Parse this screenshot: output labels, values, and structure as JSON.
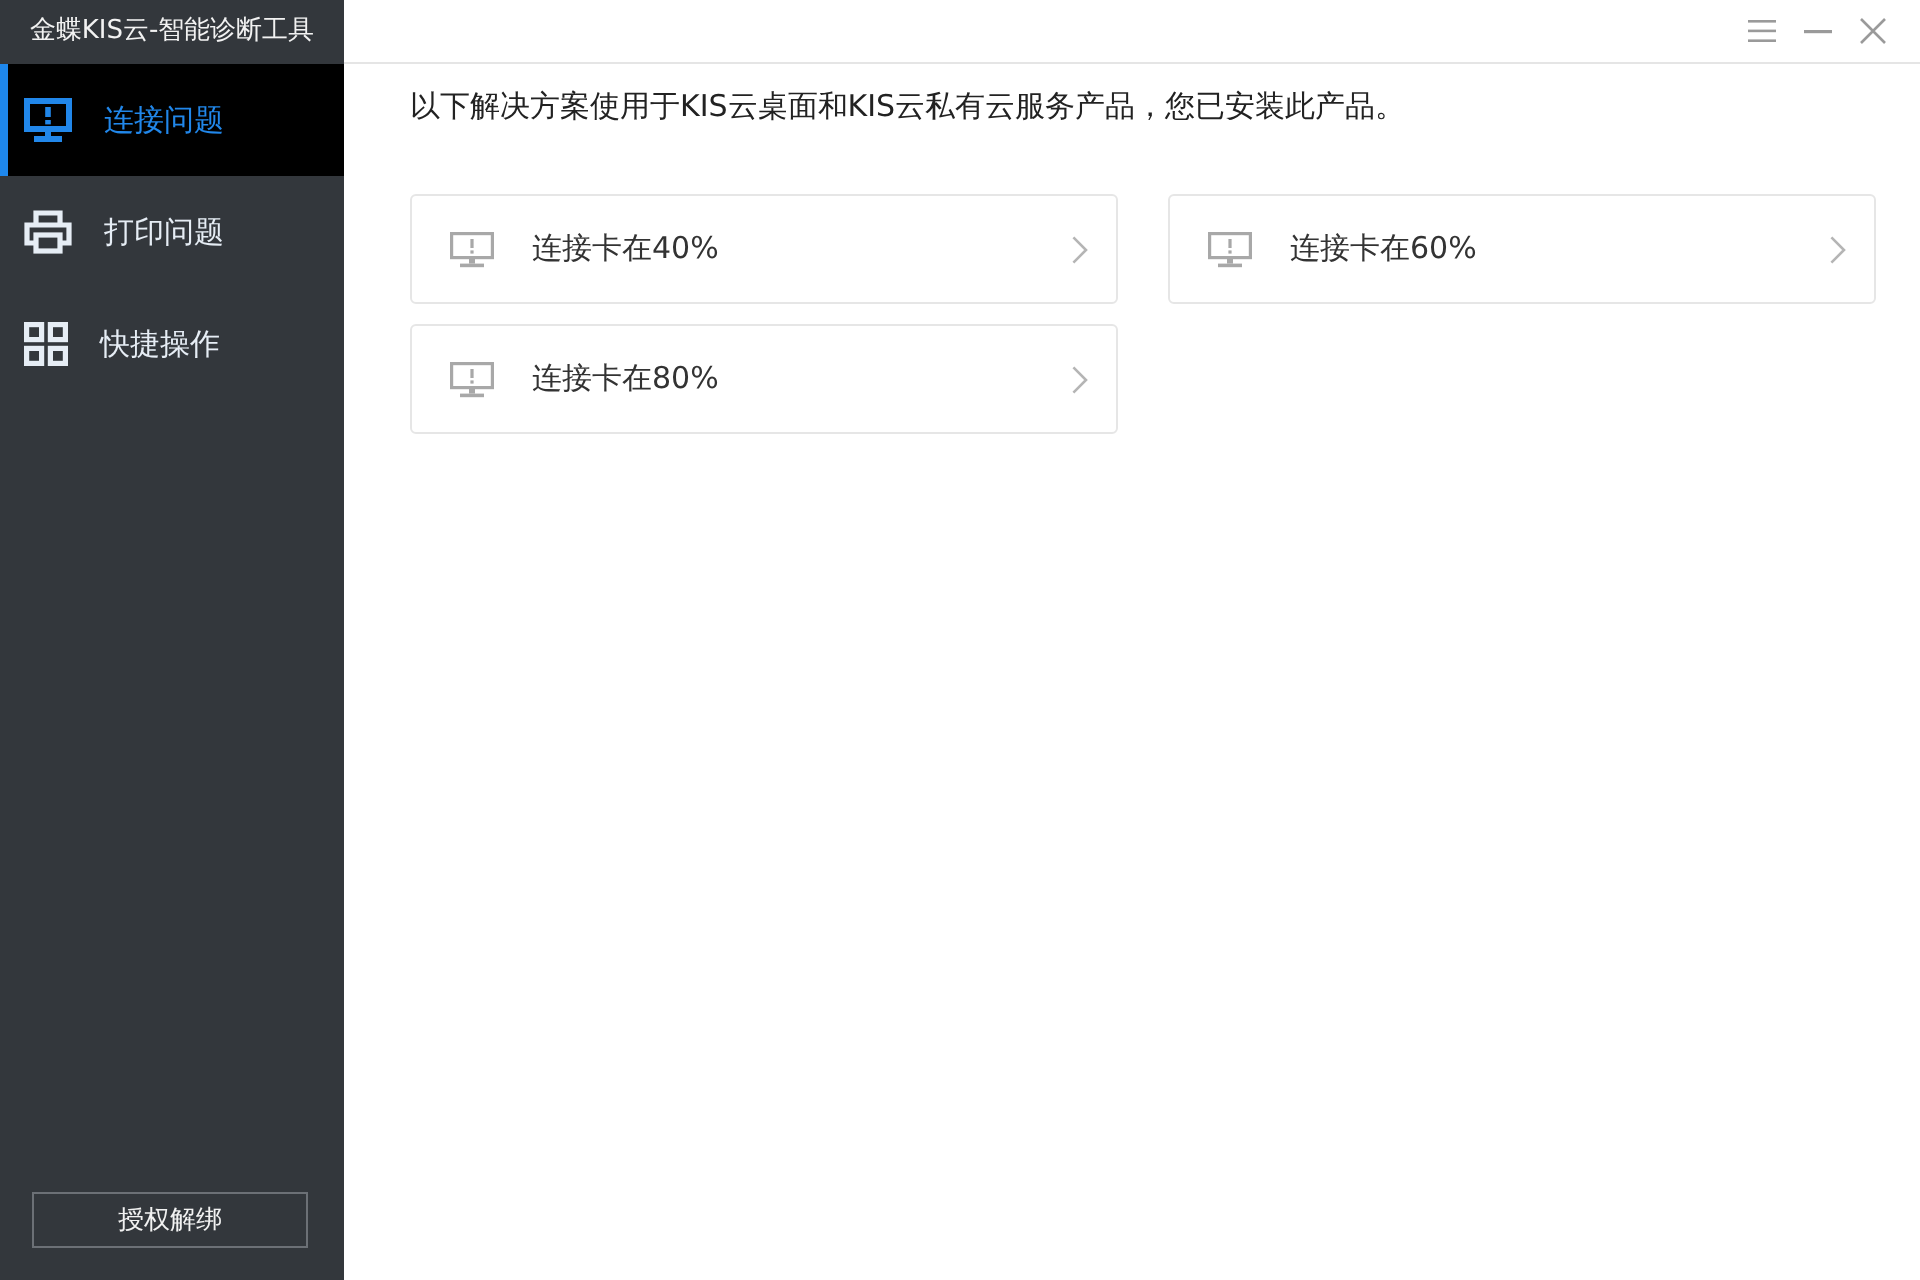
{
  "window": {
    "title": "金蝶KIS云-智能诊断工具"
  },
  "sidebar": {
    "items": [
      {
        "label": "连接问题",
        "selected": true
      },
      {
        "label": "打印问题",
        "selected": false
      },
      {
        "label": "快捷操作",
        "selected": false
      }
    ],
    "button": "授权解绑"
  },
  "content": {
    "intro": "以下解决方案使用于KIS云桌面和KIS云私有云服务产品，您已安装此产品。",
    "cards": [
      {
        "label": "连接卡在40%"
      },
      {
        "label": "连接卡在60%"
      },
      {
        "label": "连接卡在80%"
      }
    ]
  }
}
